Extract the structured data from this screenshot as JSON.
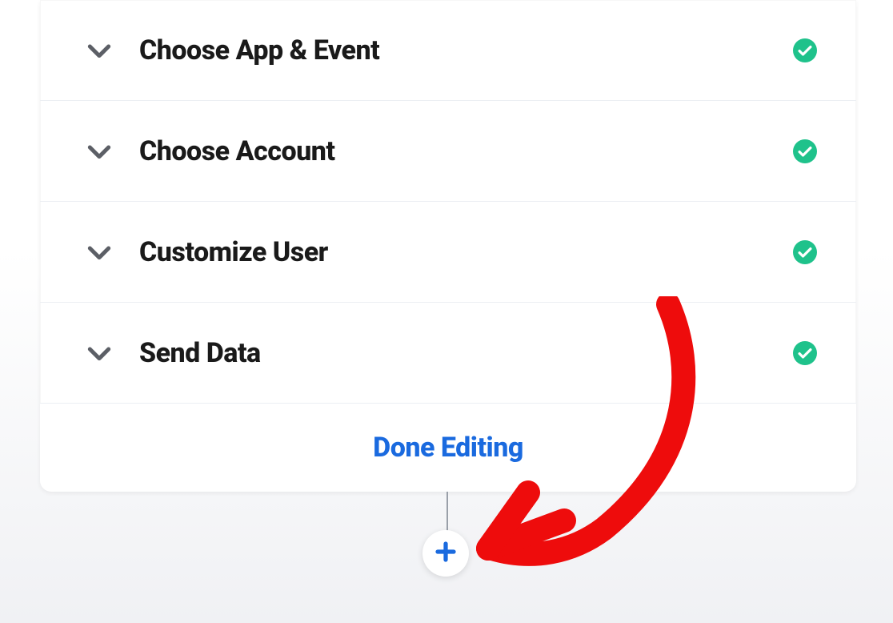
{
  "steps": [
    {
      "title": "Choose App & Event",
      "complete": true
    },
    {
      "title": "Choose Account",
      "complete": true
    },
    {
      "title": "Customize User",
      "complete": true
    },
    {
      "title": "Send Data",
      "complete": true
    }
  ],
  "footer": {
    "done_label": "Done Editing"
  },
  "colors": {
    "accent_blue": "#1a6adf",
    "success_green": "#1fc28b",
    "chevron_gray": "#5c5f66",
    "arrow_red": "#ee0c0c"
  },
  "icons": {
    "chevron": "chevron-down-icon",
    "check": "checkmark-circle-icon",
    "plus": "plus-icon"
  }
}
